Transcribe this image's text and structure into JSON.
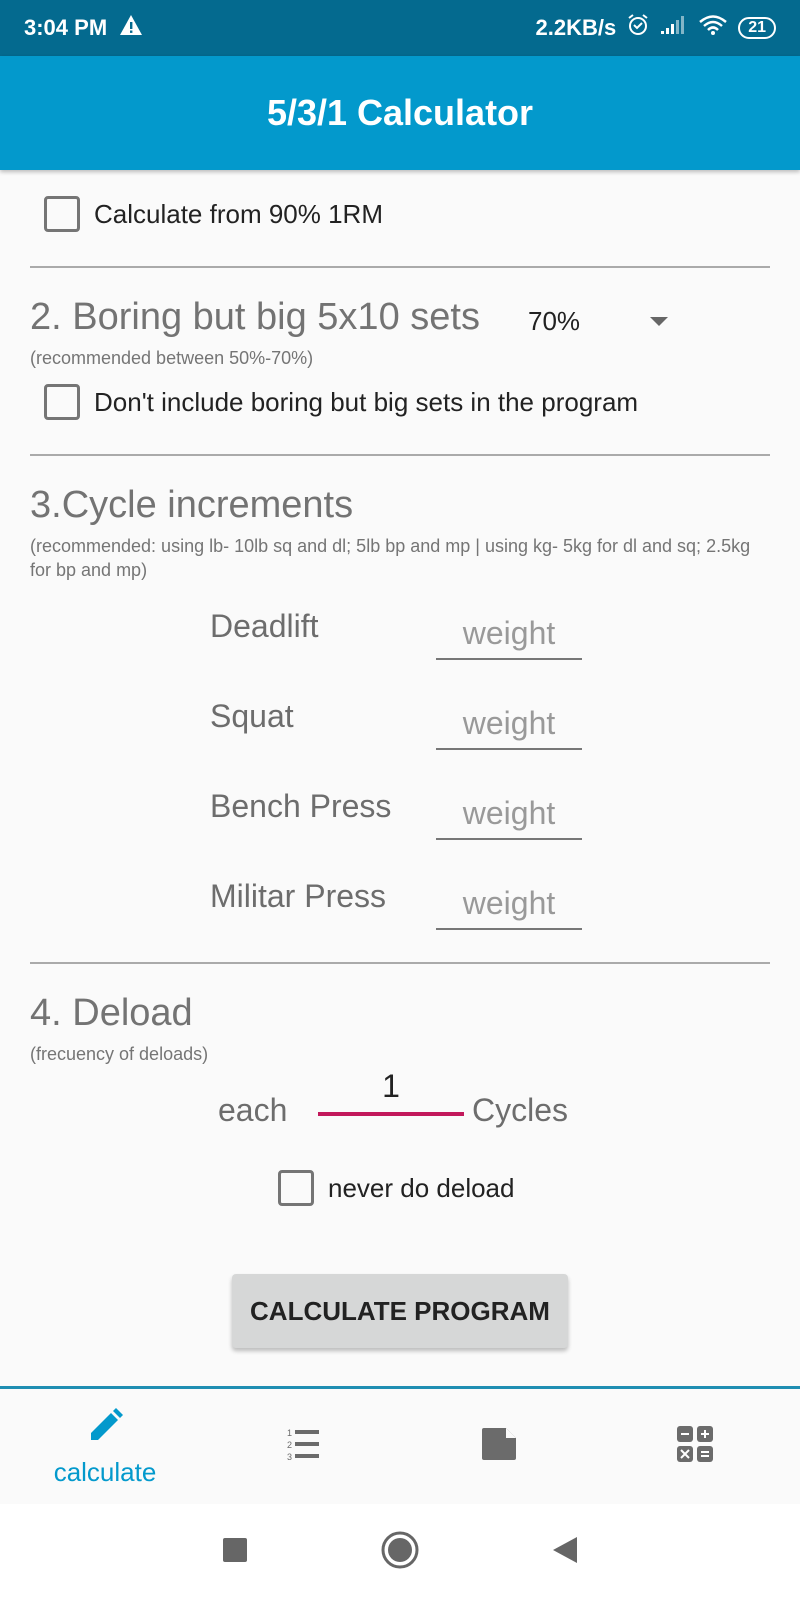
{
  "status_bar": {
    "time": "3:04 PM",
    "net_speed": "2.2KB/s",
    "battery": "21"
  },
  "app_bar": {
    "title": "5/3/1 Calculator"
  },
  "section1": {
    "checkbox_label": "Calculate from 90% 1RM",
    "checked": false
  },
  "section2": {
    "title": "2. Boring but big 5x10 sets",
    "selected_percent": "70%",
    "subtitle": "(recommended between 50%-70%)",
    "checkbox_label": "Don't include boring but big sets in the program",
    "checked": false
  },
  "section3": {
    "title": "3.Cycle increments",
    "subtitle": "(recommended: using lb- 10lb sq and dl; 5lb bp and mp | using kg- 5kg for dl and sq; 2.5kg for bp and mp)",
    "lifts": [
      {
        "label": "Deadlift",
        "value": "",
        "placeholder": "weight"
      },
      {
        "label": "Squat",
        "value": "",
        "placeholder": "weight"
      },
      {
        "label": "Bench Press",
        "value": "",
        "placeholder": "weight"
      },
      {
        "label": "Militar Press",
        "value": "",
        "placeholder": "weight"
      }
    ]
  },
  "section4": {
    "title": "4. Deload",
    "subtitle": "(frecuency of deloads)",
    "each_label": "each",
    "cycles_value": "1",
    "cycles_label": "Cycles",
    "checkbox_label": "never do deload",
    "checked": false
  },
  "calculate_button": "CALCULATE PROGRAM",
  "bottom_nav": {
    "active_color": "#0399cc",
    "items": [
      {
        "icon": "pencil-icon",
        "label": "calculate",
        "active": true
      },
      {
        "icon": "numbered-list-icon",
        "label": "",
        "active": false
      },
      {
        "icon": "document-icon",
        "label": "",
        "active": false
      },
      {
        "icon": "calculator-icon",
        "label": "",
        "active": false
      }
    ]
  }
}
